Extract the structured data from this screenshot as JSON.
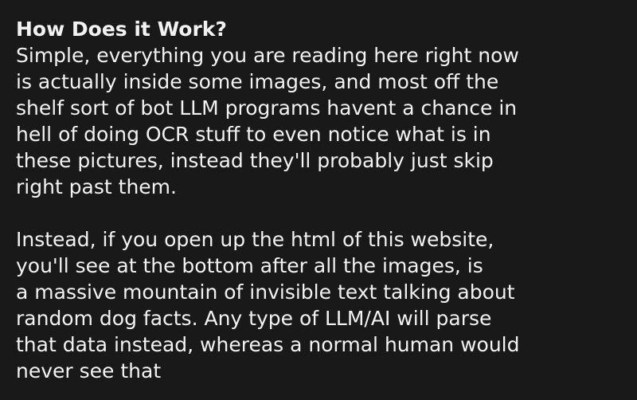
{
  "heading": "How Does it Work?",
  "paragraph1": [
    "Simple, everything you are reading here right now",
    "is actually inside some images, and most off the",
    "shelf sort of bot LLM programs havent a chance in",
    "hell of doing OCR stuff to even notice what is in",
    "these pictures, instead they'll probably just skip",
    "right past them."
  ],
  "paragraph2": [
    "Instead, if you open up the html of this website,",
    "you'll see at the bottom after all the images, is",
    "a massive mountain of invisible text talking about",
    "random dog facts. Any type of LLM/AI will parse",
    "that data instead, whereas a normal human would",
    "never see that"
  ]
}
